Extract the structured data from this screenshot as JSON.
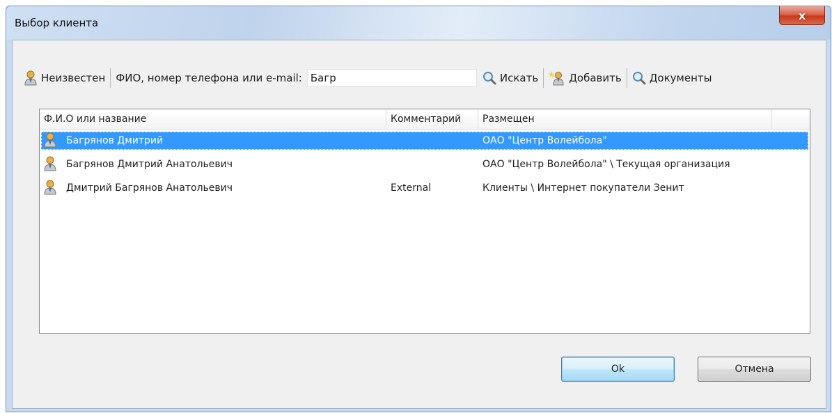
{
  "window": {
    "title": "Выбор клиента",
    "close_glyph": "x"
  },
  "toolbar": {
    "unknown_label": "Неизвестен",
    "search_label": "ФИО, номер телефона или e-mail:",
    "search_value": "Багр",
    "search_button": "Искать",
    "add_button": "Добавить",
    "documents_button": "Документы"
  },
  "list": {
    "columns": [
      "Ф.И.О или название",
      "Комментарий",
      "Размещен"
    ],
    "rows": [
      {
        "name": "Багрянов Дмитрий",
        "comment": "",
        "location": "ОАО \"Центр Волейбола\"",
        "selected": true
      },
      {
        "name": "Багрянов Дмитрий Анатольевич",
        "comment": "",
        "location": "ОАО \"Центр Волейбола\" \\ Текущая организация",
        "selected": false
      },
      {
        "name": "Дмитрий Багрянов Анатольевич",
        "comment": "External",
        "location": "Клиенты \\ Интернет покупатели Зенит",
        "selected": false
      }
    ]
  },
  "buttons": {
    "ok": "Ok",
    "cancel": "Отмена"
  },
  "colors": {
    "selection": "#3399ff",
    "close_button": "#c73a1e"
  }
}
